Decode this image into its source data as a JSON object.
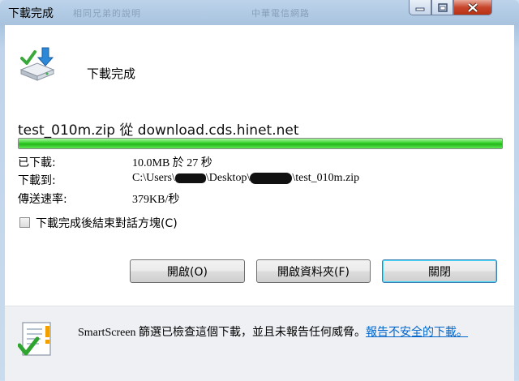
{
  "window": {
    "title": "下載完成",
    "ghost_title_1": "相同兄弟的說明",
    "ghost_title_2": "中華電信網路"
  },
  "header": {
    "title": "下載完成"
  },
  "download": {
    "source_line": "test_010m.zip 從 download.cds.hinet.net",
    "progress": 1.0
  },
  "info": {
    "downloaded_label": "已下載:",
    "downloaded_value": "10.0MB 於 27 秒",
    "dest_label": "下載到:",
    "dest_prefix": "C:\\Users\\",
    "dest_mid": "\\Desktop\\",
    "dest_suffix": "\\test_010m.zip",
    "rate_label": "傳送速率:",
    "rate_value": "379KB/秒"
  },
  "options": {
    "close_when_done_label": "下載完成後結束對話方塊(C)",
    "close_when_done_checked": false
  },
  "buttons": {
    "open": "開啟(O)",
    "open_folder": "開啟資料夾(F)",
    "close": "關閉"
  },
  "footer": {
    "smartscreen_text": "SmartScreen 篩選已檢查這個下載，並且未報告任何威脅。",
    "report_link": "報告不安全的下載。"
  },
  "colors": {
    "progress": "#22b619",
    "link": "#0066cc"
  },
  "icons": {
    "header": "download-to-drive-icon",
    "smartscreen": "security-check-icon"
  }
}
